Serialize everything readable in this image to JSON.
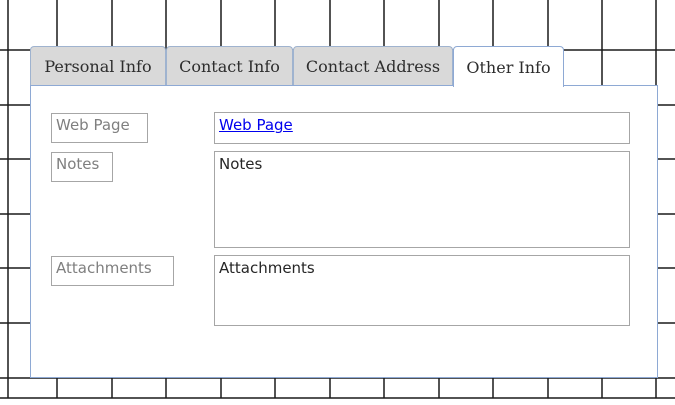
{
  "tabs": [
    {
      "label": "Personal Info",
      "active": false
    },
    {
      "label": "Contact Info",
      "active": false
    },
    {
      "label": "Contact Address",
      "active": false
    },
    {
      "label": "Other Info",
      "active": true
    }
  ],
  "fields": {
    "web_page": {
      "label": "Web Page",
      "value": "Web Page"
    },
    "notes": {
      "label": "Notes",
      "value": "Notes"
    },
    "attachments": {
      "label": "Attachments",
      "value": "Attachments"
    }
  },
  "colors": {
    "link": "#0000ee",
    "tab_inactive": "#d9d9d9",
    "tab_border": "#8ea9d4"
  }
}
